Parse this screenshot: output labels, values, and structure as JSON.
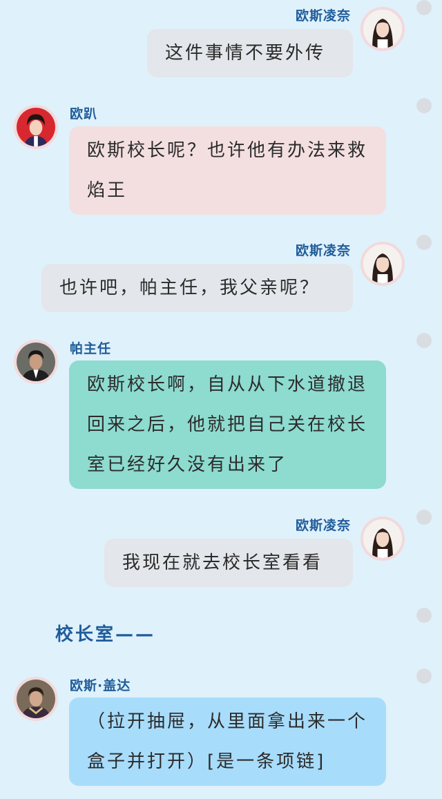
{
  "messages": [
    {
      "speaker": "欧斯凌奈",
      "side": "right",
      "avatar": "girl-avatar-icon",
      "text": "这件事情不要外传"
    },
    {
      "speaker": "欧趴",
      "side": "left",
      "avatar": "boy-red-avatar-icon",
      "text": "欧斯校长呢？也许他有办法来救焰王"
    },
    {
      "speaker": "欧斯凌奈",
      "side": "right",
      "avatar": "girl-avatar-icon",
      "text": "也许吧，帕主任，我父亲呢？"
    },
    {
      "speaker": "帕主任",
      "side": "left",
      "avatar": "man-suit-avatar-icon",
      "text": "欧斯校长啊，自从从下水道撤退回来之后，他就把自己关在校长室已经好久没有出来了"
    },
    {
      "speaker": "欧斯凌奈",
      "side": "right",
      "avatar": "girl-avatar-icon",
      "text": "我现在就去校长室看看"
    },
    {
      "speaker": "欧斯·盖达",
      "side": "left",
      "avatar": "man-robe-avatar-icon",
      "text": "（拉开抽屉，从里面拿出来一个盒子并打开）[是一条项链]"
    }
  ],
  "scene_label": "校长室——",
  "colors": {
    "background": "#dff1fb",
    "name": "#1f5c9a",
    "bubble_gray": "#e3e6ea",
    "bubble_pink": "#f3dfe0",
    "bubble_teal": "#8edbd0",
    "bubble_blue": "#a8dcfb"
  }
}
